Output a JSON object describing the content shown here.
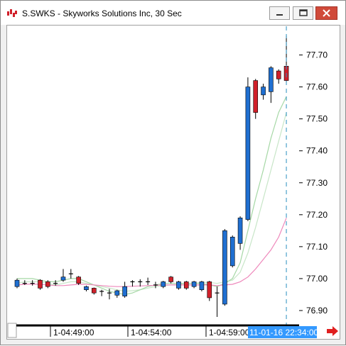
{
  "window": {
    "title": "S.SWKS - Skyworks Solutions Inc, 30 Sec"
  },
  "icons": {
    "app": "app-chart-icon",
    "minimize": "minimize-icon",
    "maximize": "maximize-icon",
    "close": "close-icon",
    "scroll_right": "red-arrow-right-icon"
  },
  "colors": {
    "up_candle": "#1f6fd1",
    "down_candle": "#d0202a",
    "ma_fast": "#a6d8a6",
    "ma_slow": "#c8e6c8",
    "ma_pink": "#ee88bb",
    "cursor_line": "#2a8fbf",
    "highlight": "#3399ff"
  },
  "chart_data": {
    "type": "candlestick",
    "title": "",
    "y_ticks": [
      "77.70",
      "77.60",
      "77.50",
      "77.40",
      "77.30",
      "77.20",
      "77.10",
      "77.00",
      "76.90"
    ],
    "ylim": [
      76.86,
      77.79
    ],
    "x_labels": [
      "1-04:49:00",
      "1-04:54:00",
      "1-04:59:00"
    ],
    "cursor_label": "11-01-16 22:34:00",
    "candles": [
      {
        "o": 76.975,
        "c": 76.995,
        "h": 77.0,
        "l": 76.97
      },
      {
        "o": 76.985,
        "c": 76.985,
        "h": 76.995,
        "l": 76.98
      },
      {
        "o": 76.985,
        "c": 76.985,
        "h": 76.995,
        "l": 76.978
      },
      {
        "o": 76.995,
        "c": 76.97,
        "h": 76.998,
        "l": 76.965
      },
      {
        "o": 76.99,
        "c": 76.975,
        "h": 76.995,
        "l": 76.97
      },
      {
        "o": 76.985,
        "c": 76.985,
        "h": 76.995,
        "l": 76.978
      },
      {
        "o": 76.995,
        "c": 77.005,
        "h": 77.03,
        "l": 76.99
      },
      {
        "o": 77.015,
        "c": 77.015,
        "h": 77.03,
        "l": 77.0
      },
      {
        "o": 77.005,
        "c": 76.985,
        "h": 77.008,
        "l": 76.98
      },
      {
        "o": 76.965,
        "c": 76.975,
        "h": 76.978,
        "l": 76.96
      },
      {
        "o": 76.97,
        "c": 76.955,
        "h": 76.972,
        "l": 76.95
      },
      {
        "o": 76.96,
        "c": 76.96,
        "h": 76.965,
        "l": 76.945
      },
      {
        "o": 76.955,
        "c": 76.955,
        "h": 76.968,
        "l": 76.935
      },
      {
        "o": 76.948,
        "c": 76.962,
        "h": 76.965,
        "l": 76.94
      },
      {
        "o": 76.945,
        "c": 76.975,
        "h": 76.99,
        "l": 76.94
      },
      {
        "o": 76.99,
        "c": 76.99,
        "h": 76.995,
        "l": 76.975
      },
      {
        "o": 76.99,
        "c": 76.99,
        "h": 76.998,
        "l": 76.975
      },
      {
        "o": 76.99,
        "c": 76.99,
        "h": 77.003,
        "l": 76.98
      },
      {
        "o": 76.98,
        "c": 76.98,
        "h": 76.99,
        "l": 76.97
      },
      {
        "o": 76.975,
        "c": 76.99,
        "h": 76.993,
        "l": 76.97
      },
      {
        "o": 77.005,
        "c": 76.99,
        "h": 77.008,
        "l": 76.985
      },
      {
        "o": 76.97,
        "c": 76.99,
        "h": 76.993,
        "l": 76.965
      },
      {
        "o": 76.99,
        "c": 76.97,
        "h": 76.993,
        "l": 76.965
      },
      {
        "o": 76.975,
        "c": 76.99,
        "h": 76.993,
        "l": 76.97
      },
      {
        "o": 76.965,
        "c": 76.99,
        "h": 76.993,
        "l": 76.96
      },
      {
        "o": 76.99,
        "c": 76.94,
        "h": 76.993,
        "l": 76.93
      },
      {
        "o": 76.955,
        "c": 76.955,
        "h": 76.975,
        "l": 76.88
      },
      {
        "o": 76.92,
        "c": 77.15,
        "h": 77.155,
        "l": 76.915
      },
      {
        "o": 77.04,
        "c": 77.13,
        "h": 77.135,
        "l": 77.035
      },
      {
        "o": 77.11,
        "c": 77.19,
        "h": 77.195,
        "l": 77.09
      },
      {
        "o": 77.185,
        "c": 77.6,
        "h": 77.63,
        "l": 77.18
      },
      {
        "o": 77.62,
        "c": 77.52,
        "h": 77.625,
        "l": 77.5
      },
      {
        "o": 77.575,
        "c": 77.6,
        "h": 77.61,
        "l": 77.56
      },
      {
        "o": 77.585,
        "c": 77.66,
        "h": 77.665,
        "l": 77.55
      },
      {
        "o": 77.65,
        "c": 77.625,
        "h": 77.655,
        "l": 77.61
      },
      {
        "o": 77.665,
        "c": 77.62,
        "h": 77.76,
        "l": 77.615
      }
    ],
    "ma_fast": [
      77.0,
      77.0,
      77.0,
      76.995,
      76.99,
      76.99,
      76.995,
      77.0,
      77.0,
      76.99,
      76.98,
      76.97,
      76.96,
      76.955,
      76.95,
      76.955,
      76.965,
      76.975,
      76.98,
      76.985,
      76.985,
      76.985,
      76.985,
      76.985,
      76.985,
      76.98,
      76.975,
      76.985,
      77.0,
      77.05,
      77.15,
      77.25,
      77.34,
      77.44,
      77.52,
      77.57
    ],
    "ma_slow": [
      76.985,
      76.99,
      76.99,
      76.99,
      76.985,
      76.98,
      76.985,
      76.99,
      76.99,
      76.985,
      76.98,
      76.975,
      76.97,
      76.965,
      76.96,
      76.962,
      76.965,
      76.97,
      76.975,
      76.978,
      76.98,
      76.982,
      76.985,
      76.985,
      76.988,
      76.988,
      76.985,
      76.99,
      76.995,
      77.02,
      77.08,
      77.16,
      77.25,
      77.34,
      77.43,
      77.52
    ],
    "ma_pink": [
      76.98,
      76.982,
      76.983,
      76.982,
      76.98,
      76.978,
      76.978,
      76.98,
      76.982,
      76.982,
      76.98,
      76.978,
      76.976,
      76.975,
      76.975,
      76.976,
      76.977,
      76.978,
      76.979,
      76.98,
      76.98,
      76.98,
      76.98,
      76.98,
      76.98,
      76.98,
      76.978,
      76.98,
      76.982,
      76.99,
      77.005,
      77.03,
      77.06,
      77.09,
      77.13,
      77.19
    ]
  }
}
